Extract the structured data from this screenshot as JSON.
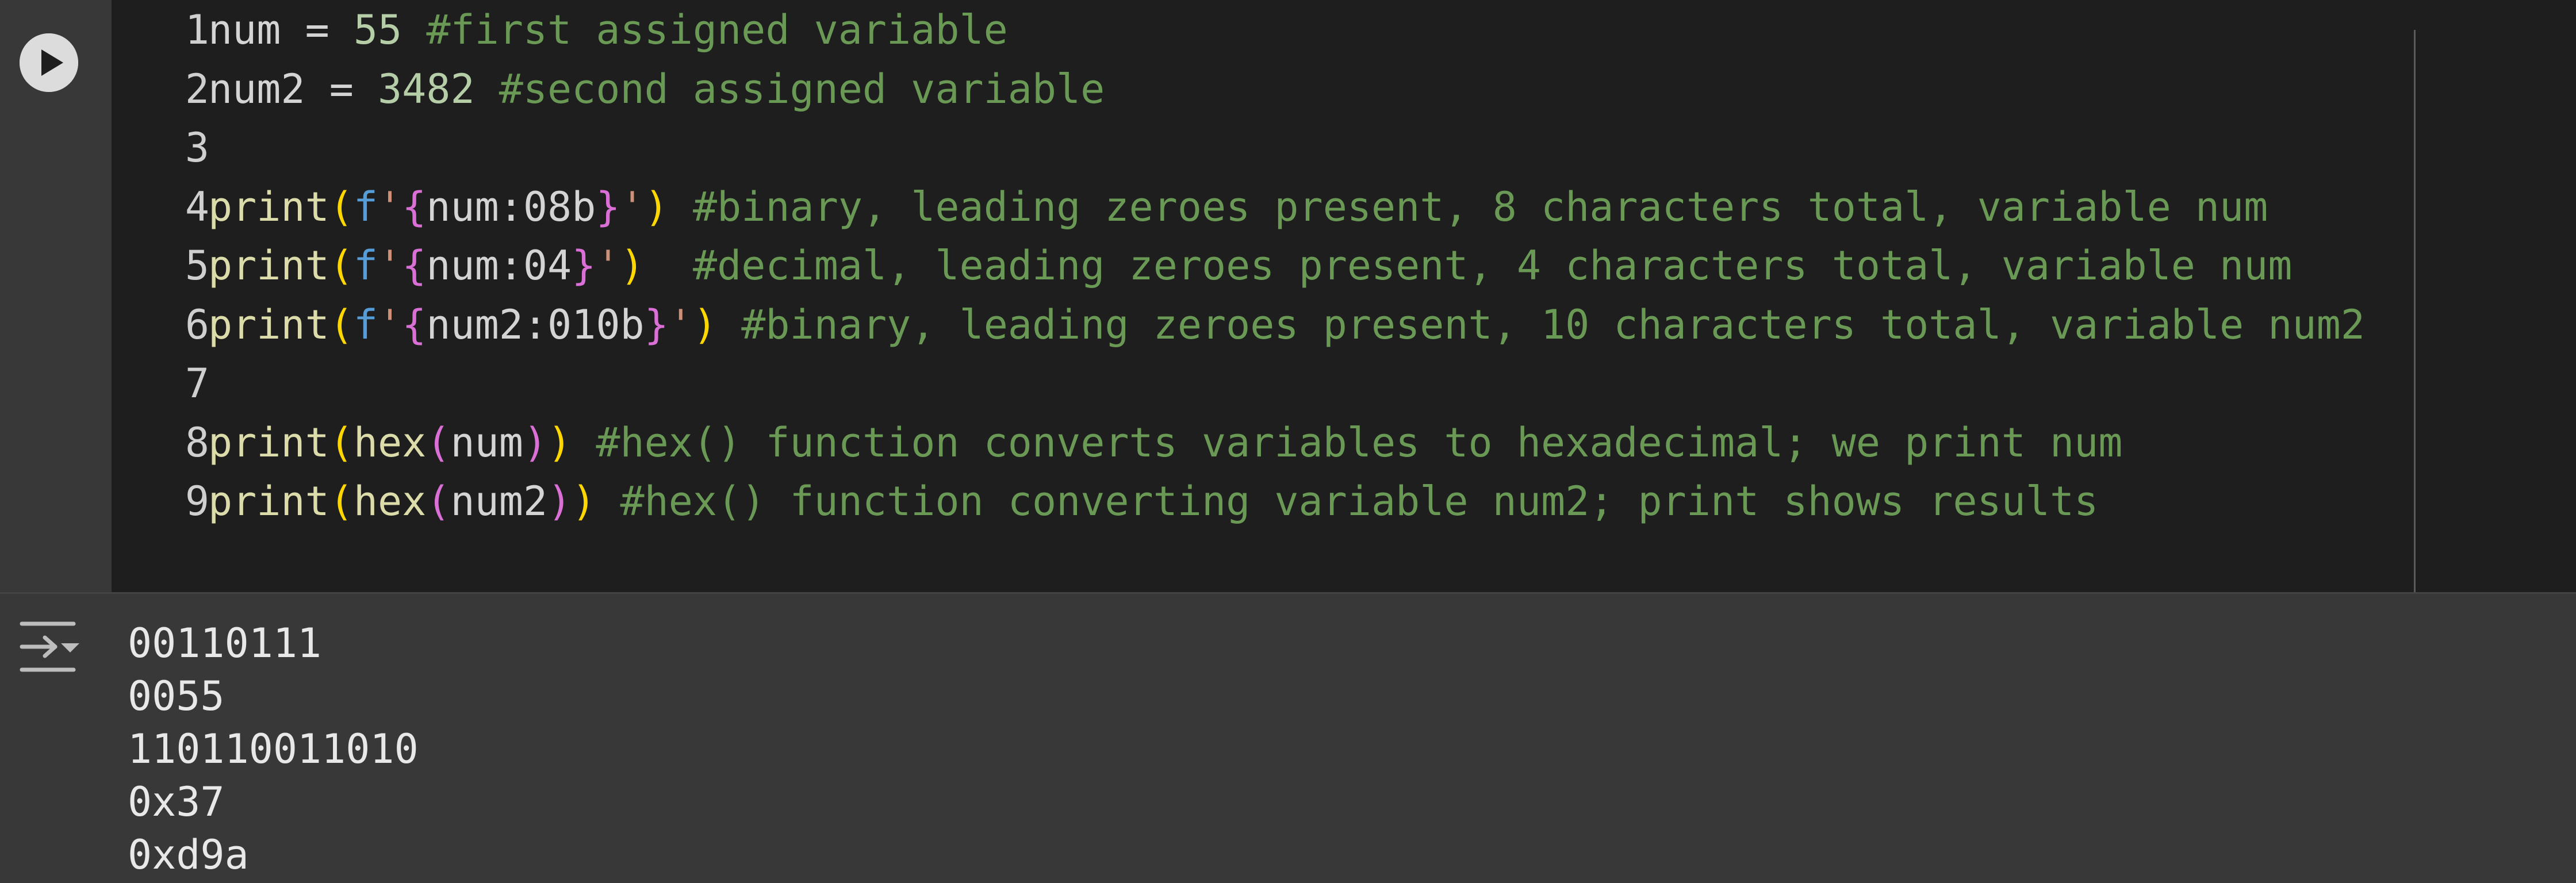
{
  "cell": {
    "run_button": {
      "icon": "play-icon"
    },
    "lines": [
      {
        "num": "1",
        "tokens": [
          {
            "t": "num",
            "c": "var"
          },
          {
            "t": " = ",
            "c": "op"
          },
          {
            "t": "55",
            "c": "num"
          },
          {
            "t": " #first assigned variable",
            "c": "comment"
          }
        ]
      },
      {
        "num": "2",
        "tokens": [
          {
            "t": "num2",
            "c": "var"
          },
          {
            "t": " = ",
            "c": "op"
          },
          {
            "t": "3482",
            "c": "num"
          },
          {
            "t": " #second assigned variable",
            "c": "comment"
          }
        ]
      },
      {
        "num": "3",
        "tokens": []
      },
      {
        "num": "4",
        "tokens": [
          {
            "t": "print",
            "c": "func"
          },
          {
            "t": "(",
            "c": "paren1"
          },
          {
            "t": "f",
            "c": "fprefix"
          },
          {
            "t": "'",
            "c": "str"
          },
          {
            "t": "{",
            "c": "brace"
          },
          {
            "t": "num:08b",
            "c": "fmt"
          },
          {
            "t": "}",
            "c": "brace"
          },
          {
            "t": "'",
            "c": "str"
          },
          {
            "t": ")",
            "c": "paren1"
          },
          {
            "t": " #binary, leading zeroes present, 8 characters total, variable num",
            "c": "comment"
          }
        ]
      },
      {
        "num": "5",
        "tokens": [
          {
            "t": "print",
            "c": "func"
          },
          {
            "t": "(",
            "c": "paren1"
          },
          {
            "t": "f",
            "c": "fprefix"
          },
          {
            "t": "'",
            "c": "str"
          },
          {
            "t": "{",
            "c": "brace"
          },
          {
            "t": "num:04",
            "c": "fmt"
          },
          {
            "t": "}",
            "c": "brace"
          },
          {
            "t": "'",
            "c": "str"
          },
          {
            "t": ")",
            "c": "paren1"
          },
          {
            "t": "  #decimal, leading zeroes present, 4 characters total, variable num",
            "c": "comment"
          }
        ]
      },
      {
        "num": "6",
        "tokens": [
          {
            "t": "print",
            "c": "func"
          },
          {
            "t": "(",
            "c": "paren1"
          },
          {
            "t": "f",
            "c": "fprefix"
          },
          {
            "t": "'",
            "c": "str"
          },
          {
            "t": "{",
            "c": "brace"
          },
          {
            "t": "num2:010b",
            "c": "fmt"
          },
          {
            "t": "}",
            "c": "brace"
          },
          {
            "t": "'",
            "c": "str"
          },
          {
            "t": ")",
            "c": "paren1"
          },
          {
            "t": " #binary, leading zeroes present, 10 characters total, variable num2",
            "c": "comment"
          }
        ]
      },
      {
        "num": "7",
        "tokens": []
      },
      {
        "num": "8",
        "tokens": [
          {
            "t": "print",
            "c": "func"
          },
          {
            "t": "(",
            "c": "paren1"
          },
          {
            "t": "hex",
            "c": "func"
          },
          {
            "t": "(",
            "c": "paren2"
          },
          {
            "t": "num",
            "c": "var"
          },
          {
            "t": ")",
            "c": "paren2"
          },
          {
            "t": ")",
            "c": "paren1"
          },
          {
            "t": " #hex() function converts variables to hexadecimal; we print num",
            "c": "comment"
          }
        ]
      },
      {
        "num": "9",
        "tokens": [
          {
            "t": "print",
            "c": "func"
          },
          {
            "t": "(",
            "c": "paren1"
          },
          {
            "t": "hex",
            "c": "func"
          },
          {
            "t": "(",
            "c": "paren2"
          },
          {
            "t": "num2",
            "c": "var"
          },
          {
            "t": ")",
            "c": "paren2"
          },
          {
            "t": ")",
            "c": "paren1"
          },
          {
            "t": " #hex() function converting variable num2; print shows results",
            "c": "comment"
          }
        ]
      }
    ]
  },
  "output": {
    "toggle_icon": "output-settings-icon",
    "lines": [
      "00110111",
      "0055",
      "110110011010",
      "0x37",
      "0xd9a"
    ]
  },
  "colors": {
    "editor_bg": "#1e1e1e",
    "gutter_bg": "#383838",
    "comment": "#6a9955",
    "number": "#b5cea8",
    "function": "#dcdcaa",
    "paren_gold": "#ffd700",
    "paren_magenta": "#da70d6",
    "fprefix_blue": "#569cd6",
    "string": "#ce9178"
  }
}
